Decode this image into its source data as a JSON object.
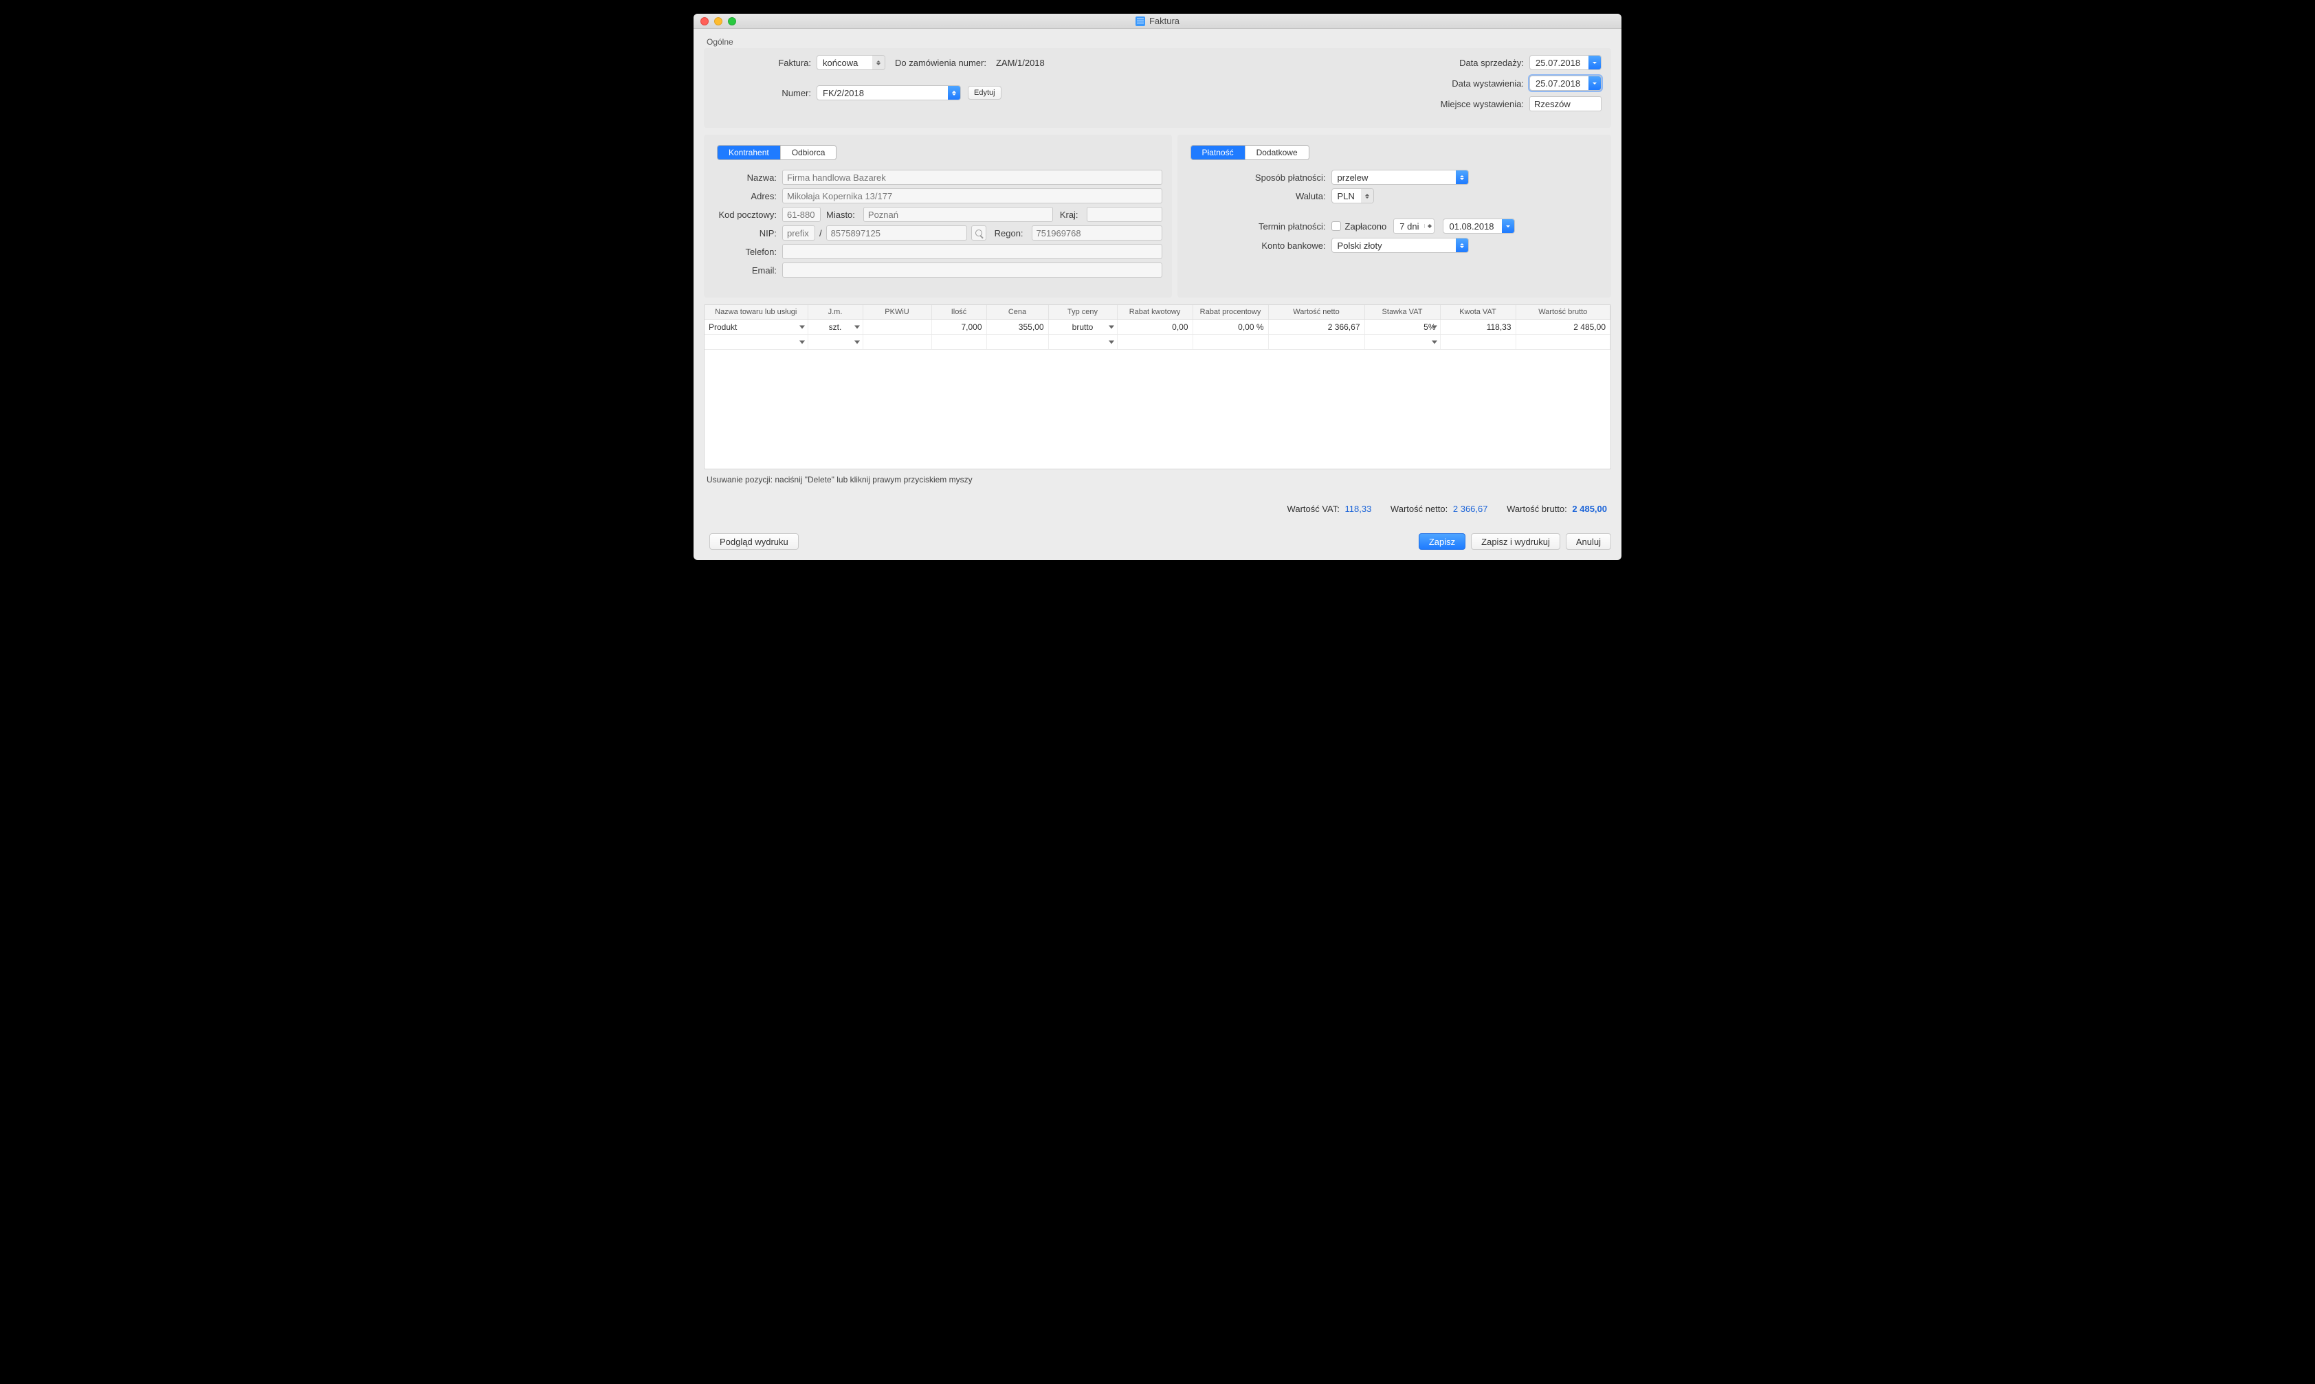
{
  "window": {
    "title": "Faktura"
  },
  "general_label": "Ogólne",
  "header": {
    "faktura_label": "Faktura:",
    "faktura_value": "końcowa",
    "order_label": "Do zamówienia numer:",
    "order_value": "ZAM/1/2018",
    "numer_label": "Numer:",
    "numer_value": "FK/2/2018",
    "edit_label": "Edytuj",
    "date_sale_label": "Data sprzedaży:",
    "date_sale_value": "25.07.2018",
    "date_issue_label": "Data wystawienia:",
    "date_issue_value": "25.07.2018",
    "place_issue_label": "Miejsce wystawienia:",
    "place_issue_value": "Rzeszów"
  },
  "party": {
    "tabs": {
      "kontrahent": "Kontrahent",
      "odbiorca": "Odbiorca"
    },
    "nazwa_label": "Nazwa:",
    "nazwa_value": "Firma handlowa Bazarek",
    "adres_label": "Adres:",
    "adres_value": "Mikołaja Kopernika 13/177",
    "kod_label": "Kod pocztowy:",
    "kod_value": "61-880",
    "miasto_label": "Miasto:",
    "miasto_value": "Poznań",
    "kraj_label": "Kraj:",
    "kraj_value": "",
    "nip_label": "NIP:",
    "nip_prefix_placeholder": "prefix",
    "nip_sep": "/",
    "nip_value": "8575897125",
    "regon_label": "Regon:",
    "regon_value": "751969768",
    "telefon_label": "Telefon:",
    "telefon_value": "",
    "email_label": "Email:",
    "email_value": ""
  },
  "payment": {
    "tabs": {
      "platnosc": "Płatność",
      "dodatkowe": "Dodatkowe"
    },
    "method_label": "Sposób płatności:",
    "method_value": "przelew",
    "currency_label": "Waluta:",
    "currency_value": "PLN",
    "term_label": "Termin płatności:",
    "paid_label": "Zapłacono",
    "days_value": "7 dni",
    "due_value": "01.08.2018",
    "account_label": "Konto bankowe:",
    "account_value": "Polski złoty"
  },
  "table": {
    "headers": [
      "Nazwa towaru lub usługi",
      "J.m.",
      "PKWiU",
      "Ilość",
      "Cena",
      "Typ ceny",
      "Rabat kwotowy",
      "Rabat procentowy",
      "Wartość netto",
      "Stawka VAT",
      "Kwota VAT",
      "Wartość brutto"
    ],
    "rows": [
      {
        "name": "Produkt",
        "jm": "szt.",
        "pkwiu": "",
        "qty": "7,000",
        "price": "355,00",
        "type": "brutto",
        "disc_amt": "0,00",
        "disc_pct": "0,00 %",
        "net": "2 366,67",
        "vat_rate": "5%",
        "vat": "118,33",
        "gross": "2 485,00"
      }
    ]
  },
  "hint": "Usuwanie pozycji: naciśnij \"Delete\" lub kliknij prawym przyciskiem myszy",
  "totals": {
    "vat_label": "Wartość VAT:",
    "vat_value": "118,33",
    "net_label": "Wartość netto:",
    "net_value": "2 366,67",
    "gross_label": "Wartość brutto:",
    "gross_value": "2 485,00"
  },
  "footer": {
    "preview": "Podgląd wydruku",
    "save": "Zapisz",
    "save_print": "Zapisz i wydrukuj",
    "cancel": "Anuluj"
  }
}
